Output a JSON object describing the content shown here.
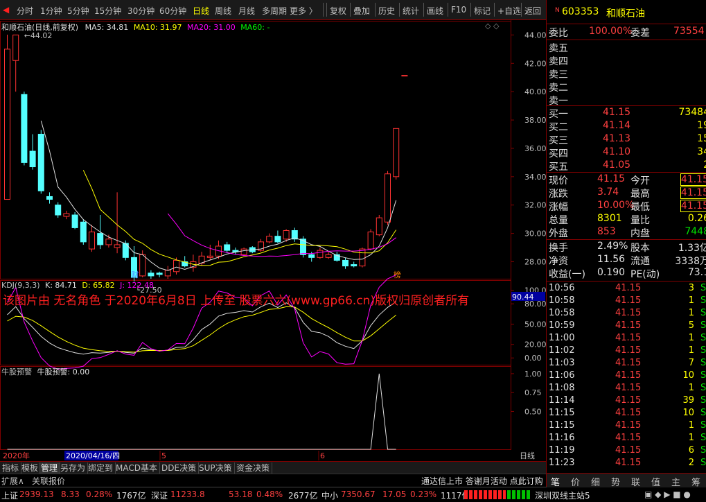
{
  "toolbar": {
    "periods": [
      "分时",
      "1分钟",
      "5分钟",
      "15分钟",
      "30分钟",
      "60分钟",
      "日线",
      "周线",
      "月线",
      "多周期",
      "更多 〉"
    ],
    "active_period": "日线",
    "tools": [
      "复权",
      "叠加",
      "历史",
      "统计",
      "画线",
      "F10",
      "标记",
      "+自选",
      "返回"
    ]
  },
  "chart_header": {
    "stock": "和顺石油(日线,前复权)",
    "ma5": "MA5: 34.81",
    "ma10": "MA10: 31.97",
    "ma20": "MA20: 31.00",
    "ma60": "MA60: -",
    "high_label": "44.02",
    "low_label": "27.50",
    "fin_marker": "财",
    "rank_marker": "榜"
  },
  "kdj": {
    "title": "KDJ(9,3,3)",
    "k": "K: 84.71",
    "d": "D: 65.82",
    "j": "J: 122.48",
    "current": "90.44"
  },
  "watermark": "该图片由 无名角色 于2020年6月8日 上传至 股票六六(www.gp66.cn)版权归原创者所有",
  "alert": {
    "title": "牛股预警",
    "value": "牛股预警: 0.00"
  },
  "x_axis": {
    "year": "2020年",
    "cursor_date": "2020/04/16/四",
    "month5": "5",
    "month6": "6",
    "period": "日线"
  },
  "tabs": [
    "指标",
    "模板",
    "管理",
    "另存为",
    "绑定到",
    "MACD基本",
    "DDE决策",
    "SUP决策",
    "资金决策"
  ],
  "tabs2": [
    "扩展∧",
    "关联报价"
  ],
  "right_footer_text": "通达信上市 答谢月活动 点此订购",
  "status": {
    "sh": {
      "label": "上证",
      "price": "2939.13",
      "chg": "8.33",
      "pct": "0.28%",
      "amt": "1767亿"
    },
    "sz": {
      "label": "深证",
      "price": "11233.8",
      "chg": "53.18",
      "pct": "0.48%",
      "amt": "2677亿"
    },
    "zx": {
      "label": "中小",
      "price": "7350.67",
      "chg": "17.05",
      "pct": "0.23%",
      "amt": "1117亿"
    },
    "server": "深圳双线主站5"
  },
  "quote": {
    "code": "603353",
    "name": "和顺石油",
    "weibi_label": "委比",
    "weibi": "100.00%",
    "weicha_label": "委差",
    "weicha": "73554",
    "sells": [
      {
        "label": "卖五",
        "price": "",
        "vol": ""
      },
      {
        "label": "卖四",
        "price": "",
        "vol": ""
      },
      {
        "label": "卖三",
        "price": "",
        "vol": ""
      },
      {
        "label": "卖二",
        "price": "",
        "vol": ""
      },
      {
        "label": "卖一",
        "price": "",
        "vol": ""
      }
    ],
    "buys": [
      {
        "label": "买一",
        "price": "41.15",
        "vol": "73484"
      },
      {
        "label": "买二",
        "price": "41.14",
        "vol": "19"
      },
      {
        "label": "买三",
        "price": "41.13",
        "vol": "15"
      },
      {
        "label": "买四",
        "price": "41.10",
        "vol": "34"
      },
      {
        "label": "买五",
        "price": "41.05",
        "vol": "2"
      }
    ],
    "stats": [
      {
        "l1": "现价",
        "v1": "41.15",
        "l2": "今开",
        "v2": "41.15"
      },
      {
        "l1": "涨跌",
        "v1": "3.74",
        "l2": "最高",
        "v2": "41.15"
      },
      {
        "l1": "涨幅",
        "v1": "10.00%",
        "l2": "最低",
        "v2": "41.15"
      },
      {
        "l1": "总量",
        "v1": "8301",
        "l2": "量比",
        "v2": "0.26"
      },
      {
        "l1": "外盘",
        "v1": "853",
        "l2": "内盘",
        "v2": "7448"
      }
    ],
    "fund": [
      {
        "l1": "换手",
        "v1": "2.49%",
        "l2": "股本",
        "v2": "1.33亿"
      },
      {
        "l1": "净资",
        "v1": "11.56",
        "l2": "流通",
        "v2": "3338万"
      },
      {
        "l1": "收益(一)",
        "v1": "0.190",
        "l2": "PE(动)",
        "v2": "73.1"
      }
    ],
    "ticks": [
      {
        "t": "10:56",
        "p": "41.15",
        "v": "3",
        "s": "S"
      },
      {
        "t": "10:58",
        "p": "41.15",
        "v": "1",
        "s": "S"
      },
      {
        "t": "10:58",
        "p": "41.15",
        "v": "1",
        "s": "S"
      },
      {
        "t": "10:59",
        "p": "41.15",
        "v": "5",
        "s": "S"
      },
      {
        "t": "11:00",
        "p": "41.15",
        "v": "1",
        "s": "S"
      },
      {
        "t": "11:02",
        "p": "41.15",
        "v": "1",
        "s": "S"
      },
      {
        "t": "11:03",
        "p": "41.15",
        "v": "7",
        "s": "S"
      },
      {
        "t": "11:06",
        "p": "41.15",
        "v": "10",
        "s": "S"
      },
      {
        "t": "11:08",
        "p": "41.15",
        "v": "1",
        "s": "S"
      },
      {
        "t": "11:14",
        "p": "41.15",
        "v": "39",
        "s": "S"
      },
      {
        "t": "11:15",
        "p": "41.15",
        "v": "10",
        "s": "S"
      },
      {
        "t": "11:15",
        "p": "41.15",
        "v": "1",
        "s": "S"
      },
      {
        "t": "11:16",
        "p": "41.15",
        "v": "1",
        "s": "S"
      },
      {
        "t": "11:19",
        "p": "41.15",
        "v": "6",
        "s": "S"
      },
      {
        "t": "11:23",
        "p": "41.15",
        "v": "2",
        "s": "S"
      }
    ],
    "rtabs": [
      "笔",
      "价",
      "细",
      "势",
      "联",
      "值",
      "主",
      "筹"
    ]
  },
  "chart_data": {
    "type": "candlestick",
    "price_axis": {
      "ticks": [
        28.0,
        30.0,
        32.0,
        34.0,
        36.0,
        38.0,
        40.0,
        42.0,
        44.0
      ],
      "ylim": [
        26.8,
        45.0
      ]
    },
    "candles": [
      {
        "o": 32.4,
        "c": 43.0,
        "h": 44.02,
        "l": 32.4
      },
      {
        "o": 42.2,
        "c": 44.0,
        "h": 44.02,
        "l": 40.0
      },
      {
        "o": 39.8,
        "c": 35.0,
        "h": 40.0,
        "l": 34.8
      },
      {
        "o": 35.8,
        "c": 34.7,
        "h": 37.0,
        "l": 34.5
      },
      {
        "o": 37.0,
        "c": 33.0,
        "h": 37.3,
        "l": 32.8
      },
      {
        "o": 32.6,
        "c": 32.4,
        "h": 32.9,
        "l": 32.1
      },
      {
        "o": 32.0,
        "c": 31.3,
        "h": 32.2,
        "l": 31.1
      },
      {
        "o": 31.2,
        "c": 31.4,
        "h": 31.6,
        "l": 31.0
      },
      {
        "o": 31.3,
        "c": 30.4,
        "h": 31.5,
        "l": 30.3
      },
      {
        "o": 30.8,
        "c": 29.4,
        "h": 31.0,
        "l": 29.2
      },
      {
        "o": 28.9,
        "c": 30.1,
        "h": 30.6,
        "l": 28.7
      },
      {
        "o": 30.0,
        "c": 29.2,
        "h": 31.3,
        "l": 28.9
      },
      {
        "o": 29.2,
        "c": 29.6,
        "h": 29.9,
        "l": 29.0
      },
      {
        "o": 29.0,
        "c": 29.2,
        "h": 32.9,
        "l": 28.6
      },
      {
        "o": 29.3,
        "c": 28.3,
        "h": 29.5,
        "l": 28.1
      },
      {
        "o": 28.3,
        "c": 26.9,
        "h": 29.1,
        "l": 26.6
      },
      {
        "o": 27.0,
        "c": 28.5,
        "h": 28.8,
        "l": 26.9
      },
      {
        "o": 27.2,
        "c": 27.0,
        "h": 27.4,
        "l": 26.8
      },
      {
        "o": 27.2,
        "c": 27.1,
        "h": 27.3,
        "l": 26.9
      },
      {
        "o": 27.0,
        "c": 27.4,
        "h": 27.7,
        "l": 26.8
      },
      {
        "o": 27.3,
        "c": 28.1,
        "h": 28.3,
        "l": 27.1
      },
      {
        "o": 28.0,
        "c": 27.7,
        "h": 28.4,
        "l": 27.6
      },
      {
        "o": 27.6,
        "c": 28.0,
        "h": 28.5,
        "l": 27.3
      },
      {
        "o": 27.9,
        "c": 28.4,
        "h": 28.7,
        "l": 27.7
      },
      {
        "o": 28.3,
        "c": 28.4,
        "h": 29.2,
        "l": 28.1
      },
      {
        "o": 28.4,
        "c": 29.1,
        "h": 29.5,
        "l": 28.2
      },
      {
        "o": 29.2,
        "c": 28.8,
        "h": 29.4,
        "l": 28.6
      },
      {
        "o": 28.8,
        "c": 28.7,
        "h": 29.0,
        "l": 28.5
      },
      {
        "o": 28.5,
        "c": 28.9,
        "h": 29.0,
        "l": 28.4
      },
      {
        "o": 29.0,
        "c": 28.7,
        "h": 29.1,
        "l": 28.6
      },
      {
        "o": 28.8,
        "c": 29.4,
        "h": 29.6,
        "l": 28.7
      },
      {
        "o": 29.4,
        "c": 29.8,
        "h": 30.0,
        "l": 29.3
      },
      {
        "o": 29.8,
        "c": 29.4,
        "h": 30.2,
        "l": 29.3
      },
      {
        "o": 29.6,
        "c": 30.2,
        "h": 30.3,
        "l": 29.4
      },
      {
        "o": 30.2,
        "c": 29.6,
        "h": 30.4,
        "l": 29.4
      },
      {
        "o": 29.6,
        "c": 28.5,
        "h": 29.8,
        "l": 28.3
      },
      {
        "o": 28.5,
        "c": 28.3,
        "h": 28.7,
        "l": 28.0
      },
      {
        "o": 28.3,
        "c": 28.8,
        "h": 29.0,
        "l": 28.2
      },
      {
        "o": 28.3,
        "c": 28.5,
        "h": 28.7,
        "l": 28.2
      },
      {
        "o": 28.5,
        "c": 28.1,
        "h": 28.7,
        "l": 28.0
      },
      {
        "o": 28.1,
        "c": 27.7,
        "h": 28.3,
        "l": 27.5
      },
      {
        "o": 27.8,
        "c": 27.7,
        "h": 28.0,
        "l": 27.6
      },
      {
        "o": 27.7,
        "c": 28.9,
        "h": 29.0,
        "l": 27.6
      },
      {
        "o": 28.9,
        "c": 30.1,
        "h": 30.3,
        "l": 28.8
      },
      {
        "o": 29.9,
        "c": 31.1,
        "h": 31.3,
        "l": 29.8
      },
      {
        "o": 30.8,
        "c": 34.2,
        "h": 34.4,
        "l": 30.6
      },
      {
        "o": 34.0,
        "c": 37.4,
        "h": 37.4,
        "l": 33.8
      },
      {
        "o": 41.15,
        "c": 41.15,
        "h": 41.15,
        "l": 41.15
      }
    ],
    "kdj_axis": {
      "ticks": [
        0,
        20,
        50,
        80,
        100
      ],
      "ylim": [
        -10,
        115
      ]
    },
    "alert_axis": {
      "ticks": [
        0.5,
        0.75,
        1.0
      ],
      "ylim": [
        0,
        1.1
      ]
    }
  }
}
